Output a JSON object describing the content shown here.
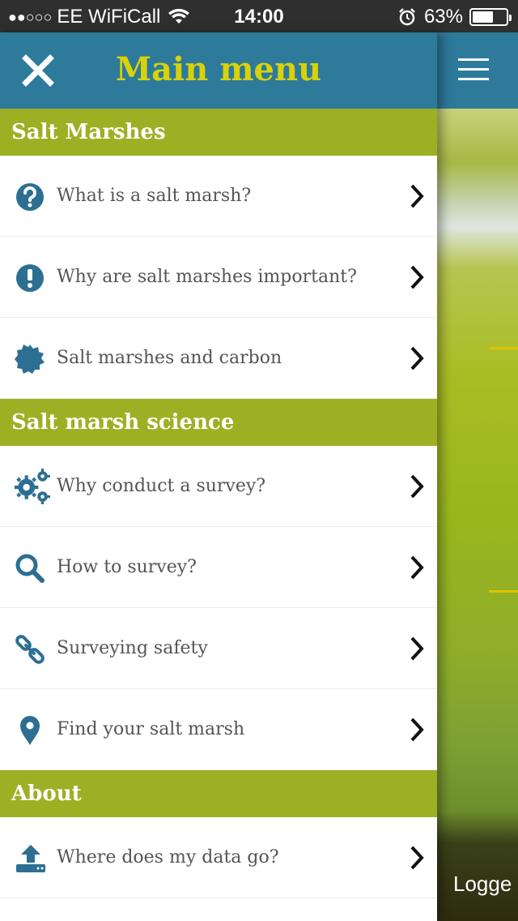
{
  "status_bar": {
    "signal": "●●○○○",
    "carrier": "EE WiFiCall",
    "time": "14:00",
    "battery": "63%",
    "battery_level": 0.63
  },
  "header": {
    "title": "Main menu",
    "close_icon": "close-icon"
  },
  "sections": [
    {
      "title": "Salt Marshes",
      "items": [
        {
          "label": "What is a salt marsh?",
          "icon": "question-circle-icon"
        },
        {
          "label": "Why are salt marshes important?",
          "icon": "exclamation-circle-icon"
        },
        {
          "label": "Salt marshes and carbon",
          "icon": "certificate-icon"
        }
      ]
    },
    {
      "title": "Salt marsh science",
      "items": [
        {
          "label": "Why conduct a survey?",
          "icon": "gears-icon"
        },
        {
          "label": "How to survey?",
          "icon": "search-icon"
        },
        {
          "label": "Surveying safety",
          "icon": "link-icon"
        },
        {
          "label": "Find your salt marsh",
          "icon": "map-marker-icon"
        }
      ]
    },
    {
      "title": "About",
      "items": [
        {
          "label": "Where does my data go?",
          "icon": "upload-icon"
        }
      ]
    }
  ],
  "background_view": {
    "logged_text": "Logge"
  },
  "colors": {
    "header": "#2d7a9b",
    "section": "#9db024",
    "title": "#d9d10a",
    "icon": "#2d6f93"
  }
}
